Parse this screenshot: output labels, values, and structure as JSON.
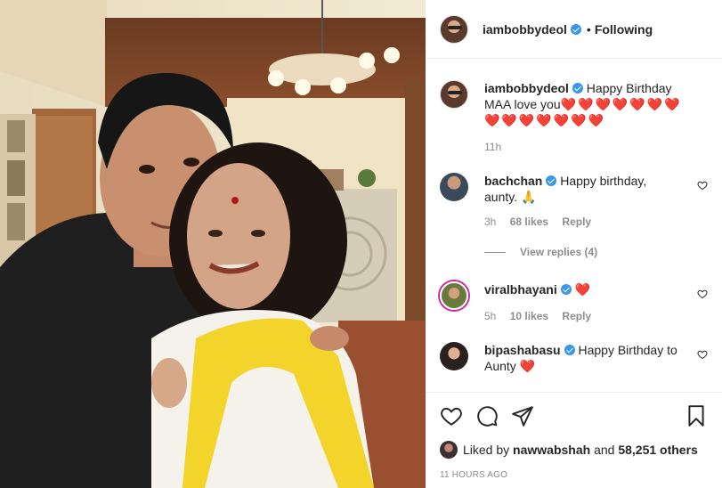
{
  "post": {
    "author": "iambobbydeol",
    "follow_status": "Following",
    "caption": "Happy Birthday MAA love you",
    "caption_hearts": "❤️❤️❤️❤️❤️❤️❤️❤️❤️❤️❤️❤️❤️❤️",
    "posted_ago": "11h",
    "liked_by_user": "nawwabshah",
    "liked_by_others": "58,251 others",
    "liked_by_prefix": "Liked by",
    "liked_by_and": "and",
    "timestamp": "11 HOURS AGO"
  },
  "comments": [
    {
      "user": "bachchan",
      "text": "Happy birthday, aunty. 🙏",
      "ago": "3h",
      "likes": "68 likes",
      "reply_label": "Reply",
      "view_replies": "View replies (4)"
    },
    {
      "user": "viralbhayani",
      "text": "❤️",
      "ago": "5h",
      "likes": "10 likes",
      "reply_label": "Reply"
    },
    {
      "user": "bipashabasu",
      "text": "Happy Birthday to Aunty ❤️"
    }
  ],
  "colors": {
    "accent_blue": "#3897f0",
    "heart_red": "#e02020",
    "muted_gray": "#8e8e8e"
  }
}
